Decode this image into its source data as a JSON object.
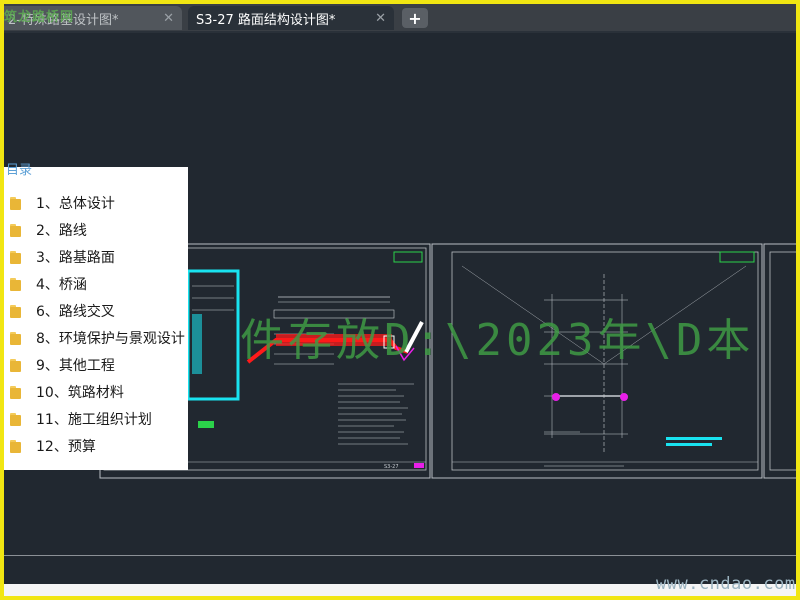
{
  "tabs": [
    {
      "label": "2-特殊路基设计图*",
      "active": false
    },
    {
      "label": "S3-27 路面结构设计图*",
      "active": true
    }
  ],
  "tab_close_icon": "close-icon",
  "tab_add_icon": "plus-icon",
  "top_watermark": "筑龙路桥网",
  "toc": {
    "header": "目录",
    "items": [
      {
        "label": "1、总体设计",
        "icon": "folder-icon"
      },
      {
        "label": "2、路线",
        "icon": "folder-icon"
      },
      {
        "label": "3、路基路面",
        "icon": "folder-icon"
      },
      {
        "label": "4、桥涵",
        "icon": "folder-icon"
      },
      {
        "label": "6、路线交叉",
        "icon": "folder-icon"
      },
      {
        "label": "8、环境保护与景观设计",
        "icon": "folder-icon"
      },
      {
        "label": "9、其他工程",
        "icon": "folder-icon"
      },
      {
        "label": "10、筑路材料",
        "icon": "folder-icon"
      },
      {
        "label": "11、施工组织计划",
        "icon": "folder-icon"
      },
      {
        "label": "12、预算",
        "icon": "folder-icon"
      }
    ]
  },
  "overlay_path_text": "件存放D:\\2023年\\D本",
  "site_watermark": "www.cndao.com",
  "sheet_labels": [
    "S3-27"
  ],
  "colors": {
    "canvas_bg": "#212830",
    "frame_border": "#f1e612",
    "cyan": "#19e3f0",
    "magenta": "#e81fe8",
    "red": "#ff1a1a",
    "green": "#2bd24a"
  }
}
